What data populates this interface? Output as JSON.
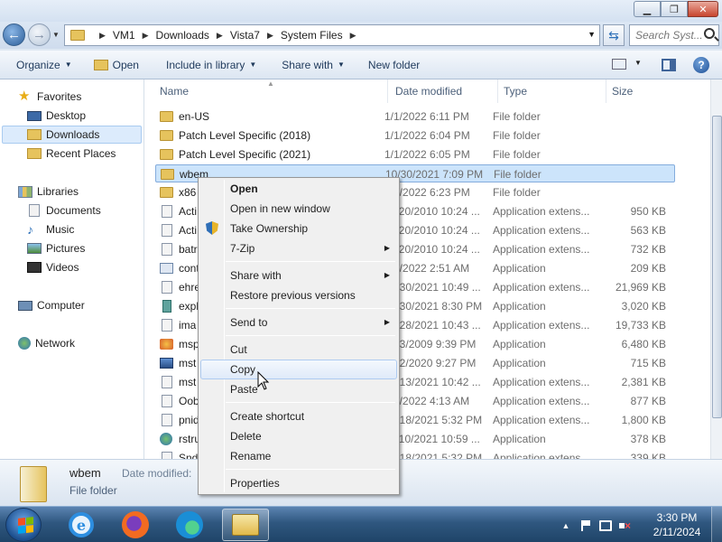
{
  "window": {
    "minimize": "▁",
    "maximize": "❐",
    "close": "✕"
  },
  "address": {
    "breadcrumbs": [
      "VM1",
      "Downloads",
      "Vista7",
      "System Files"
    ],
    "search_placeholder": "Search Syst..."
  },
  "toolbar": {
    "organize": "Organize",
    "open": "Open",
    "include_in_library": "Include in library",
    "share_with": "Share with",
    "new_folder": "New folder"
  },
  "nav": {
    "favorites": "Favorites",
    "desktop": "Desktop",
    "downloads": "Downloads",
    "recent_places": "Recent Places",
    "libraries": "Libraries",
    "documents": "Documents",
    "music": "Music",
    "pictures": "Pictures",
    "videos": "Videos",
    "computer": "Computer",
    "network": "Network"
  },
  "columns": {
    "name": "Name",
    "date_modified": "Date modified",
    "type": "Type",
    "size": "Size"
  },
  "files": [
    {
      "name": "en-US",
      "date": "1/1/2022 6:11 PM",
      "type": "File folder",
      "size": "",
      "icon": "folder-icon"
    },
    {
      "name": "Patch Level Specific (2018)",
      "date": "1/1/2022 6:04 PM",
      "type": "File folder",
      "size": "",
      "icon": "folder-icon"
    },
    {
      "name": "Patch Level Specific (2021)",
      "date": "1/1/2022 6:05 PM",
      "type": "File folder",
      "size": "",
      "icon": "folder-icon"
    },
    {
      "name": "wbem",
      "date": "10/30/2021 7:09 PM",
      "type": "File folder",
      "size": "",
      "icon": "folder-icon"
    },
    {
      "name": "x86",
      "date": "1/1/2022 6:23 PM",
      "type": "File folder",
      "size": "",
      "icon": "folder-icon"
    },
    {
      "name": "Acti",
      "date": "11/20/2010 10:24 ...",
      "type": "Application extens...",
      "size": "950 KB",
      "icon": "dll-icon"
    },
    {
      "name": "Acti",
      "date": "11/20/2010 10:24 ...",
      "type": "Application extens...",
      "size": "563 KB",
      "icon": "dll-icon"
    },
    {
      "name": "batr",
      "date": "11/20/2010 10:24 ...",
      "type": "Application extens...",
      "size": "732 KB",
      "icon": "dll-icon"
    },
    {
      "name": "cont",
      "date": "1/1/2022 2:51 AM",
      "type": "Application",
      "size": "209 KB",
      "icon": "exe-icon"
    },
    {
      "name": "ehre",
      "date": "10/30/2021 10:49 ...",
      "type": "Application extens...",
      "size": "21,969 KB",
      "icon": "dll-icon"
    },
    {
      "name": "expl",
      "date": "10/30/2021 8:30 PM",
      "type": "Application",
      "size": "3,020 KB",
      "icon": "app-icon"
    },
    {
      "name": "ima",
      "date": "10/28/2021 10:43 ...",
      "type": "Application extens...",
      "size": "19,733 KB",
      "icon": "dll-icon"
    },
    {
      "name": "msp",
      "date": "7/13/2009 9:39 PM",
      "type": "Application",
      "size": "6,480 KB",
      "icon": "msp-icon"
    },
    {
      "name": "mst",
      "date": "1/22/2020 9:27 PM",
      "type": "Application",
      "size": "715 KB",
      "icon": "mstsc-icon"
    },
    {
      "name": "mst",
      "date": "10/13/2021 10:42 ...",
      "type": "Application extens...",
      "size": "2,381 KB",
      "icon": "dll-icon"
    },
    {
      "name": "Oob",
      "date": "1/1/2022 4:13 AM",
      "type": "Application extens...",
      "size": "877 KB",
      "icon": "dll-icon"
    },
    {
      "name": "pnid",
      "date": "10/18/2021 5:32 PM",
      "type": "Application extens...",
      "size": "1,800 KB",
      "icon": "dll-icon"
    },
    {
      "name": "rstru",
      "date": "11/10/2021 10:59 ...",
      "type": "Application",
      "size": "378 KB",
      "icon": "globe-icon"
    },
    {
      "name": "Sndl",
      "date": "10/18/2021 5:32 PM",
      "type": "Application extens...",
      "size": "339 KB",
      "icon": "dll-icon"
    }
  ],
  "context_menu": {
    "open": "Open",
    "open_new_window": "Open in new window",
    "take_ownership": "Take Ownership",
    "seven_zip": "7-Zip",
    "share_with": "Share with",
    "restore_previous": "Restore previous versions",
    "send_to": "Send to",
    "cut": "Cut",
    "copy": "Copy",
    "paste": "Paste",
    "create_shortcut": "Create shortcut",
    "delete": "Delete",
    "rename": "Rename",
    "properties": "Properties"
  },
  "details": {
    "name": "wbem",
    "date_label": "Date modified:",
    "type": "File folder"
  },
  "taskbar": {
    "time": "3:30 PM",
    "date": "2/11/2024"
  }
}
